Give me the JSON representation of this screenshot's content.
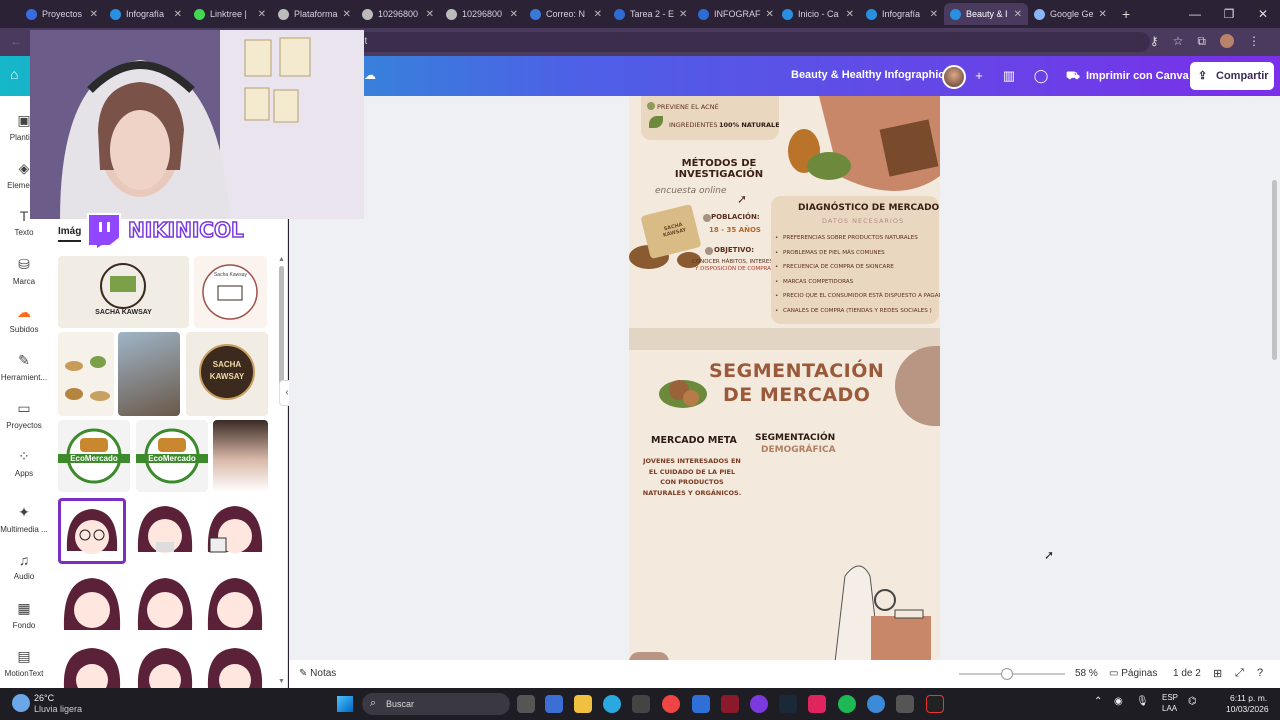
{
  "browser": {
    "tabs": [
      {
        "label": "Proyectos",
        "color": "#3c6be0"
      },
      {
        "label": "Infografía",
        "color": "#2b8fe0"
      },
      {
        "label": "Linktree |",
        "color": "#43d854"
      },
      {
        "label": "Plataforma",
        "color": "#bbbbbb"
      },
      {
        "label": "10296800",
        "color": "#bbbbbb"
      },
      {
        "label": "10296800",
        "color": "#bbbbbb"
      },
      {
        "label": "Correo: N",
        "color": "#3a79d8"
      },
      {
        "label": "Tarea 2 - E",
        "color": "#2f6bd1"
      },
      {
        "label": "INFOGRAF",
        "color": "#2f6bd1"
      },
      {
        "label": "Inicio - Ca",
        "color": "#2b8fe0"
      },
      {
        "label": "Infografía",
        "color": "#2b8fe0"
      },
      {
        "label": "Beauty & I",
        "color": "#2b8fe0"
      },
      {
        "label": "Google Ge",
        "color": "#8ab4f8"
      }
    ],
    "active_tab": "Beauty & I",
    "address_fragment": "lit"
  },
  "canva": {
    "doc_title": "Beauty & Healthy Infographic",
    "print_label": "Imprimir con Canva",
    "share_label": "Compartir"
  },
  "rail": {
    "items": [
      "Plantil...",
      "Elemen...",
      "Texto",
      "Marca",
      "Subidos",
      "Herramient...",
      "Proyectos",
      "Apps",
      "Multimedia ...",
      "Audio",
      "Fondo",
      "MotionText"
    ]
  },
  "panel": {
    "tab_label": "Imág",
    "logo1_line1": "SACHA KAWSAY",
    "logo2_line1": "Sacha Kawsay",
    "logo3_line1": "SACHA",
    "logo3_line2": "KAWSAY",
    "eco_label": "EcoMercado"
  },
  "streamer": {
    "name": "NIKINICOL"
  },
  "page": {
    "item_acne": "PREVIENE EL ACNÉ",
    "item_ingredients_pre": "INGREDIENTES",
    "item_ingredients_bold": "100% NATURALES",
    "metodos_title": "MÉTODOS DE INVESTIGACIÓN",
    "metodos_sub": "encuesta online",
    "poblacion_label": "POBLACIÓN:",
    "poblacion_value": "18 - 35 AÑOS",
    "objetivo_label": "OBJETIVO:",
    "objetivo_line1": "CONOCER HÁBITOS, INTERES",
    "objetivo_line2": "Y DISPOSICIÓN DE COMPRA",
    "soap_text": "SACHA KAWSAY",
    "diag_title": "DIAGNÓSTICO DE MERCADO",
    "diag_sub": "DATOS NECESARIOS",
    "diag_items": [
      "PREFERENCIAS SOBRE PRODUCTOS NATURALES",
      "PROBLEMAS DE PIEL MÁS COMUNES",
      "FRECUENCIA DE COMPRA DE SKINCARE",
      "MARCAS COMPETIDORAS",
      "PRECIO QUE EL CONSUMIDOR ESTÁ DISPUESTO A PAGAR",
      "CANALES DE COMPRA (TIENDAS Y REDES SOCIALES )"
    ],
    "seg_title_1": "SEGMENTACIÓN",
    "seg_title_2": "DE MERCADO",
    "meta_title": "MERCADO META",
    "meta_text": "JOVENES INTERESADOS EN EL CUIDADO DE LA PIEL CON PRODUCTOS NATURALES Y ORGÁNICOS.",
    "segdemo_1": "SEGMENTACIÓN",
    "segdemo_2": "DEMOGRÁFICA"
  },
  "bottom": {
    "notes_label": "Notas",
    "zoom_value": "58 %",
    "zoom_fraction": 0.45,
    "pages_label": "Páginas",
    "page_count": "1 de 2"
  },
  "taskbar": {
    "weather_temp": "26°C",
    "weather_desc": "Lluvia ligera",
    "search_placeholder": "Buscar",
    "lang_1": "ESP",
    "lang_2": "LAA",
    "time": "6:11 p. m.",
    "date": "10/03/2026"
  }
}
